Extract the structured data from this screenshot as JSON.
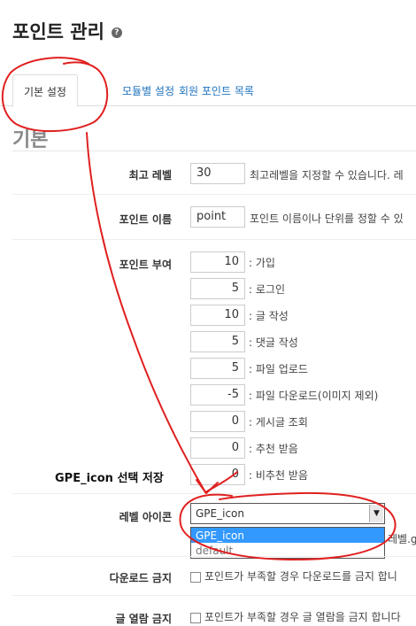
{
  "page": {
    "title": "포인트 관리"
  },
  "tabs": [
    {
      "label": "기본 설정",
      "active": true
    },
    {
      "label": "모듈별 설정",
      "active": false
    },
    {
      "label": "회원 포인트 목록",
      "active": false
    }
  ],
  "section": {
    "title": "기본"
  },
  "settings": {
    "max_level": {
      "label": "최고 레벨",
      "value": "30",
      "help": "최고레벨을 지정할 수 있습니다. 레"
    },
    "point_name": {
      "label": "포인트 이름",
      "value": "point",
      "help": "포인트 이름이나 단위를 정할 수 있"
    },
    "point_award": {
      "label": "포인트 부여",
      "items": [
        {
          "value": "10",
          "label": ": 가입"
        },
        {
          "value": "5",
          "label": ": 로그인"
        },
        {
          "value": "10",
          "label": ": 글 작성"
        },
        {
          "value": "5",
          "label": ": 댓글 작성"
        },
        {
          "value": "5",
          "label": ": 파일 업로드"
        },
        {
          "value": "-5",
          "label": ": 파일 다운로드(이미지 제외)"
        },
        {
          "value": "0",
          "label": ": 게시글 조회"
        },
        {
          "value": "0",
          "label": ": 추천 받음"
        },
        {
          "value": "0",
          "label": ": 비추천 받음"
        }
      ]
    },
    "level_icon": {
      "label": "레벨 아이콘",
      "selected": "GPE_icon",
      "options": [
        "GPE_icon",
        "default"
      ],
      "help_fragment": "레벨.g"
    },
    "download_block": {
      "label": "다운로드 금지",
      "help": "포인트가 부족할 경우 다운로드를 금지 합니"
    },
    "read_block": {
      "label": "글 열람 금지",
      "help": "포인트가 부족할 경우 글 열람을 금지 합니다"
    }
  },
  "annotation": {
    "text": "GPE_icon 선택 저장",
    "color": "#e02020"
  }
}
